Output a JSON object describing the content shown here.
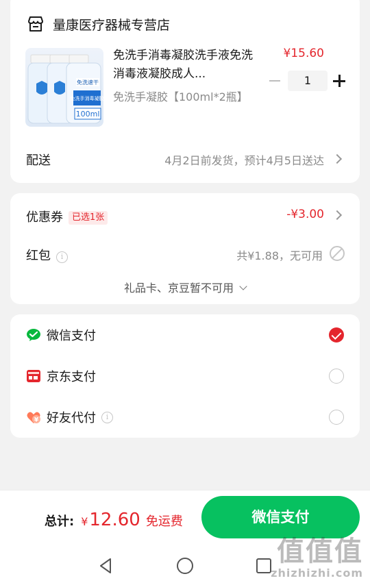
{
  "shop": {
    "name": "量康医疗器械专营店",
    "icon": "store-icon"
  },
  "product": {
    "title": "免洗手消毒凝胶洗手液免洗消毒液凝胶成人...",
    "price": "¥15.60",
    "spec": "免洗手凝胶【100ml*2瓶】",
    "quantity": "1",
    "image_text": {
      "label_top": "免洗速干",
      "label_main": "免洗手消毒凝胶",
      "volume": "100ml"
    }
  },
  "delivery": {
    "label": "配送",
    "value": "4月2日前发货，预计4月5日送达"
  },
  "coupon": {
    "label": "优惠券",
    "badge": "已选1张",
    "value": "-¥3.00"
  },
  "red_packet": {
    "label": "红包",
    "value": "共¥1.88，无可用"
  },
  "gift_card": {
    "label": "礼品卡、京豆暂不可用"
  },
  "payment": {
    "options": [
      {
        "label": "微信支付",
        "icon": "wechat-pay-icon",
        "selected": true
      },
      {
        "label": "京东支付",
        "icon": "jd-pay-icon",
        "selected": false
      },
      {
        "label": "好友代付",
        "icon": "friend-pay-icon",
        "selected": false
      }
    ]
  },
  "footer": {
    "total_label": "总计:",
    "currency": "¥",
    "amount": "12.60",
    "shipping": "免运费",
    "pay_button": "微信支付"
  },
  "watermark": {
    "big": "值值值",
    "small": "zhizhizhi.com"
  },
  "colors": {
    "price_red": "#e4262d",
    "wechat_green": "#07c160",
    "background": "#f2f2f2"
  }
}
